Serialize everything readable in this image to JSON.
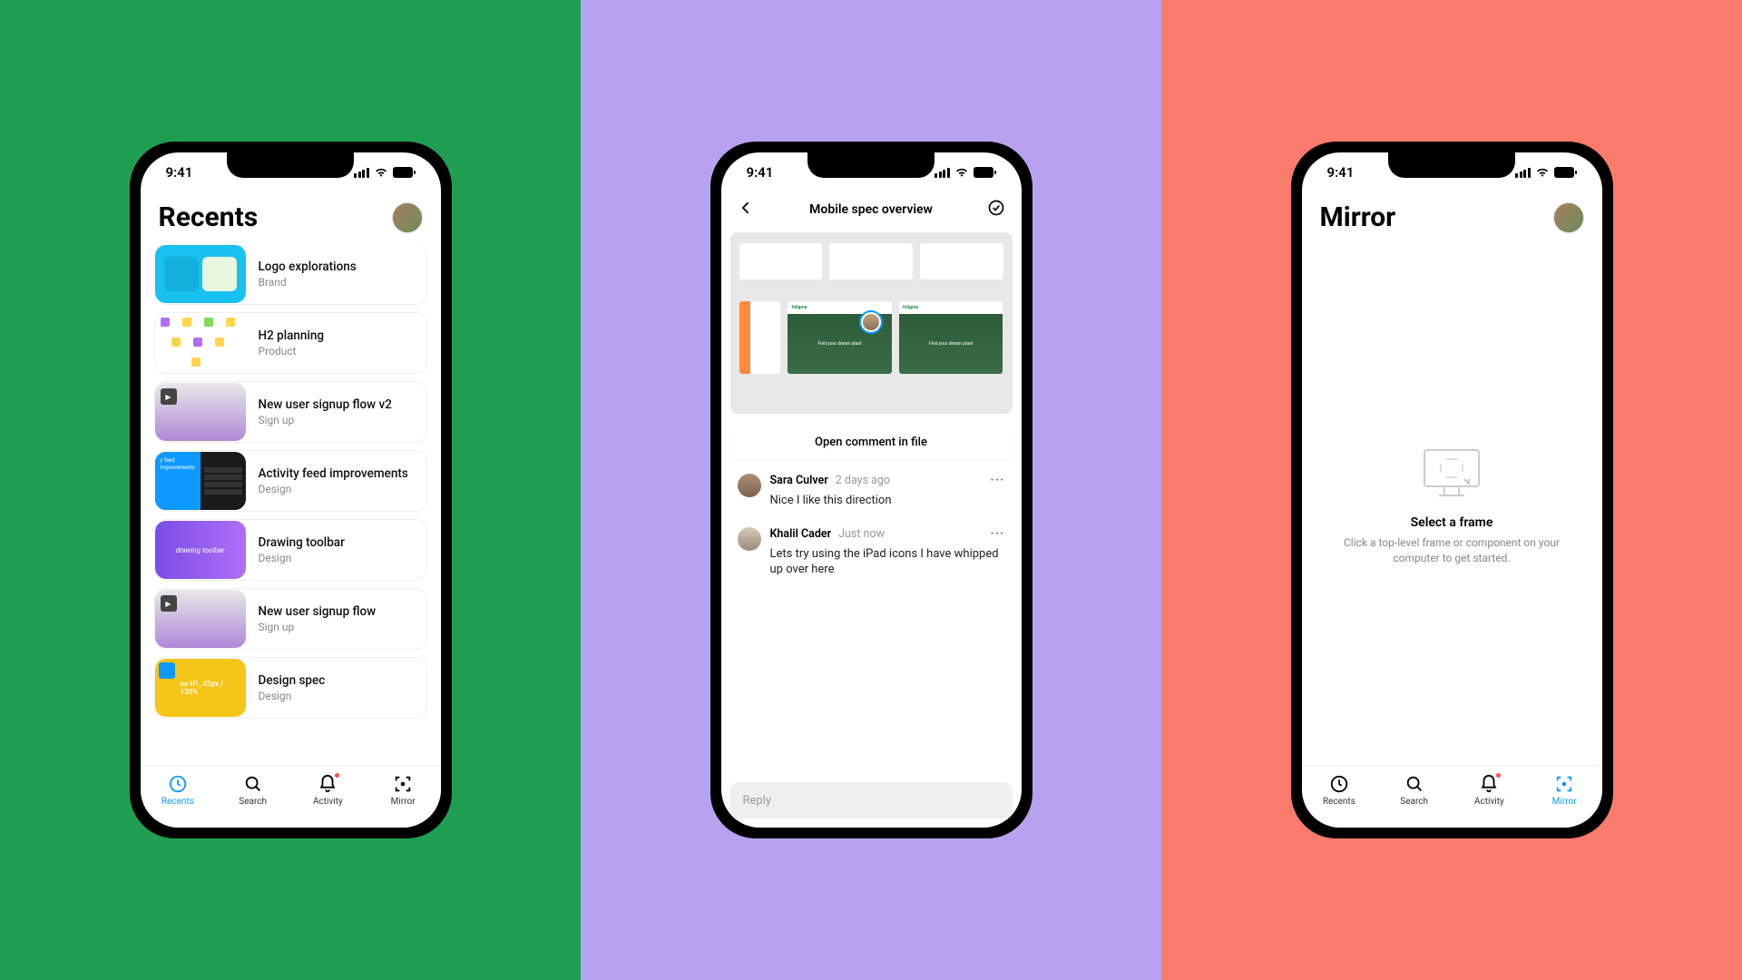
{
  "status": {
    "time": "9:41"
  },
  "recents": {
    "title": "Recents",
    "files": [
      {
        "name": "Logo explorations",
        "project": "Brand"
      },
      {
        "name": "H2 planning",
        "project": "Product"
      },
      {
        "name": "New user signup flow v2",
        "project": "Sign up"
      },
      {
        "name": "Activity feed improvements",
        "project": "Design"
      },
      {
        "name": "Drawing toolbar",
        "project": "Design"
      },
      {
        "name": "New user signup flow",
        "project": "Sign up"
      },
      {
        "name": "Design spec",
        "project": "Design"
      }
    ]
  },
  "tabs": {
    "recents": "Recents",
    "search": "Search",
    "activity": "Activity",
    "mirror": "Mirror"
  },
  "commentView": {
    "title": "Mobile spec overview",
    "openButton": "Open comment in file",
    "preview": {
      "brand": "foligma",
      "hero": "Find your dream plant"
    },
    "comments": [
      {
        "name": "Sara Culver",
        "time": "2 days ago",
        "text": "Nice I like this direction"
      },
      {
        "name": "Khalil Cader",
        "time": "Just now",
        "text": "Lets try using the iPad icons I have whipped up over here"
      }
    ],
    "replyPlaceholder": "Reply"
  },
  "mirror": {
    "title": "Mirror",
    "emptyTitle": "Select a frame",
    "emptyDesc": "Click a top-level frame or component on your computer to get started."
  },
  "thumb5_text": "drawing toolbar",
  "thumb7_text": "na H1, 42px / 130%"
}
